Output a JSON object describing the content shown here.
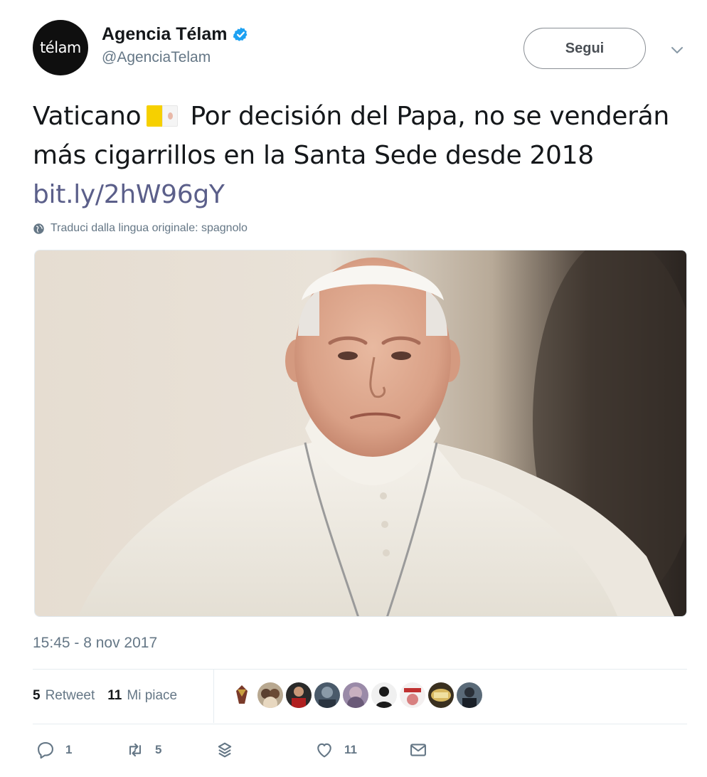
{
  "account": {
    "avatar_text": "télam",
    "display_name": "Agencia Télam",
    "handle": "@AgenciaTelam",
    "verified": true
  },
  "follow_button": {
    "label": "Segui"
  },
  "tweet": {
    "text_before_flag": "Vaticano",
    "text_after_flag": " Por decisión del Papa, no se venderán más cigarrillos en la Santa Sede desde 2018 ",
    "link": "bit.ly/2hW96gY",
    "flag_icon": "vatican-flag-icon"
  },
  "translate": {
    "label": "Traduci dalla lingua originale: spagnolo"
  },
  "timestamp": "15:45 - 8 nov 2017",
  "stats": {
    "retweets_count": "5",
    "retweets_label": "Retweet",
    "likes_count": "11",
    "likes_label": "Mi piace"
  },
  "likers": [
    "liker-1",
    "liker-2",
    "liker-3",
    "liker-4",
    "liker-5",
    "liker-6",
    "liker-7",
    "liker-8",
    "liker-9"
  ],
  "actions": {
    "reply_count": "1",
    "retweet_count": "5",
    "like_count": "11"
  },
  "colors": {
    "verified_blue": "#1da1f2",
    "muted_text": "#657786",
    "link": "#5b5f8a"
  }
}
